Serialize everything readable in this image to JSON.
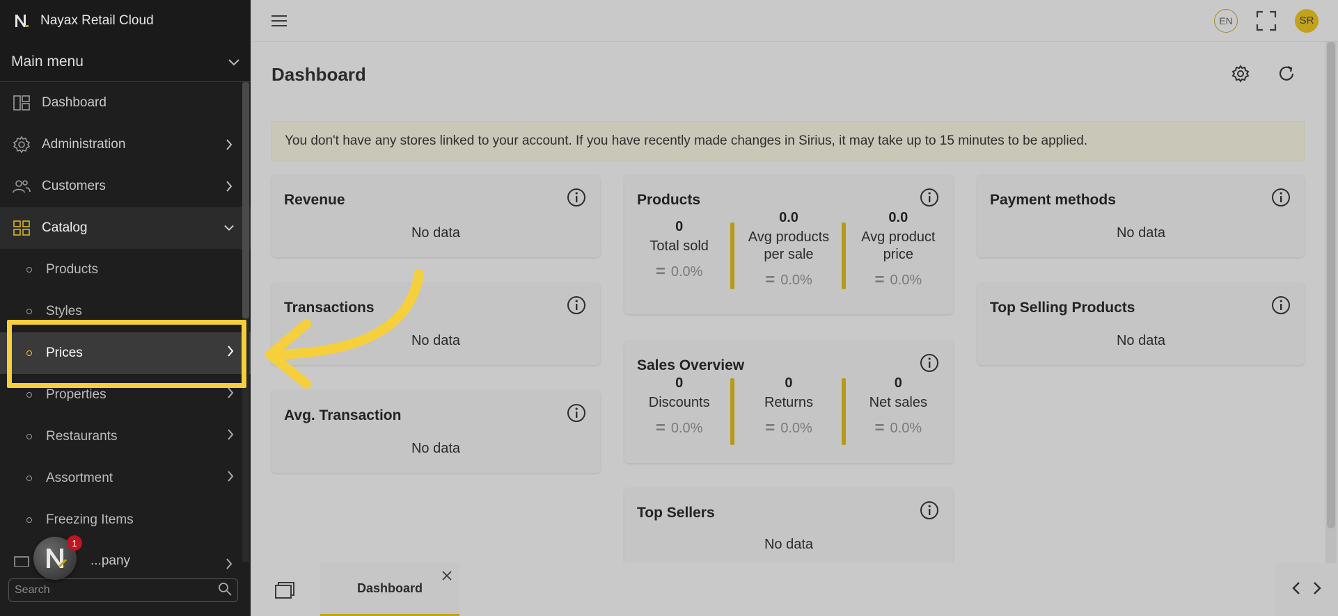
{
  "app": {
    "brand": "Nayax Retail Cloud"
  },
  "sidebar": {
    "main_menu_label": "Main menu",
    "items": [
      {
        "label": "Dashboard",
        "icon": "dashboard-icon"
      },
      {
        "label": "Administration",
        "icon": "gear-icon"
      },
      {
        "label": "Customers",
        "icon": "users-icon"
      },
      {
        "label": "Catalog",
        "icon": "grid-icon"
      }
    ],
    "catalog_sub": [
      {
        "label": "Products"
      },
      {
        "label": "Styles"
      },
      {
        "label": "Prices"
      },
      {
        "label": "Properties"
      },
      {
        "label": "Restaurants"
      },
      {
        "label": "Assortment"
      },
      {
        "label": "Freezing Items"
      }
    ],
    "partial_item": "...pany",
    "search_placeholder": "Search",
    "chat_badge": "1"
  },
  "topbar": {
    "lang": "EN",
    "avatar_initials": "SR"
  },
  "main": {
    "title": "Dashboard",
    "alert": "You don't have any stores linked to your account. If you have recently made changes in Sirius, it may take up to 15 minutes to be applied.",
    "no_data": "No data",
    "cards": {
      "revenue": "Revenue",
      "transactions": "Transactions",
      "avg_transaction": "Avg. Transaction",
      "products": "Products",
      "sales_overview": "Sales Overview",
      "top_sellers": "Top Sellers",
      "payment_methods": "Payment methods",
      "top_selling_products": "Top Selling Products"
    },
    "products_stats": [
      {
        "value": "0",
        "label": "Total sold",
        "change": "0.0%"
      },
      {
        "value": "0.0",
        "label": "Avg products per sale",
        "change": "0.0%"
      },
      {
        "value": "0.0",
        "label": "Avg product price",
        "change": "0.0%"
      }
    ],
    "sales_stats": [
      {
        "value": "0",
        "label": "Discounts",
        "change": "0.0%"
      },
      {
        "value": "0",
        "label": "Returns",
        "change": "0.0%"
      },
      {
        "value": "0",
        "label": "Net sales",
        "change": "0.0%"
      }
    ]
  },
  "bottom_tabs": [
    {
      "label": "Dashboard"
    }
  ],
  "colors": {
    "accent": "#f6cf3d",
    "sidebar_bg": "#1e1e1e",
    "gold_bar": "#b89a1a"
  }
}
